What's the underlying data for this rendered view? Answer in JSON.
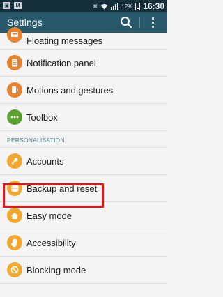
{
  "status_bar": {
    "time": "16:30",
    "battery_percent": "12%"
  },
  "app_bar": {
    "title": "Settings",
    "search_icon": "search-icon",
    "more_icon": "more-vert-icon"
  },
  "list": {
    "items_top": [
      {
        "label": "Floating messages",
        "icon": "floating-messages-icon",
        "color": "#e8822c"
      },
      {
        "label": "Notification panel",
        "icon": "notification-panel-icon",
        "color": "#e8822c"
      },
      {
        "label": "Motions and gestures",
        "icon": "motions-icon",
        "color": "#e8822c"
      },
      {
        "label": "Toolbox",
        "icon": "toolbox-icon",
        "color": "#5aa02c"
      }
    ],
    "section_header": "PERSONALISATION",
    "items_bottom": [
      {
        "label": "Accounts",
        "icon": "key-icon",
        "color": "#f0a830"
      },
      {
        "label": "Backup and reset",
        "icon": "backup-icon",
        "color": "#f0a830"
      },
      {
        "label": "Easy mode",
        "icon": "easy-mode-icon",
        "color": "#f0a830"
      },
      {
        "label": "Accessibility",
        "icon": "hand-icon",
        "color": "#f0a830"
      },
      {
        "label": "Blocking mode",
        "icon": "blocking-icon",
        "color": "#f0a830"
      }
    ]
  },
  "colors": {
    "status_bar": "#152f3a",
    "app_bar": "#27596b",
    "highlight": "#d71920"
  }
}
